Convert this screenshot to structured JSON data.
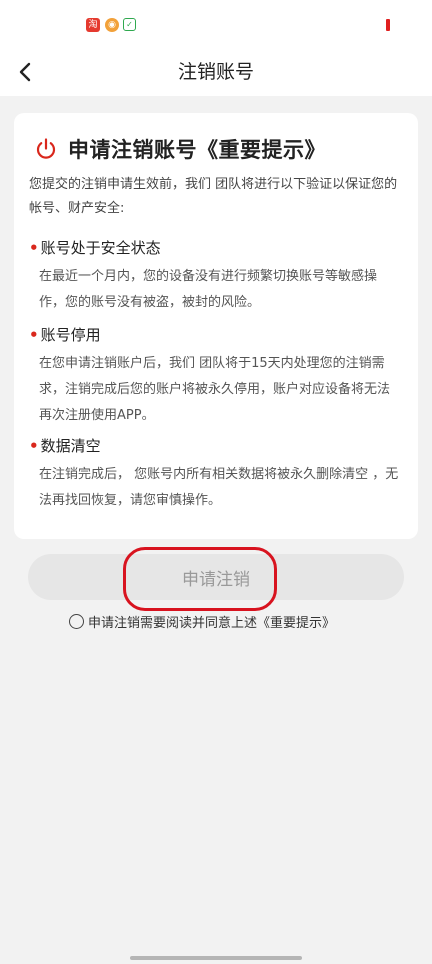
{
  "header": {
    "title": "注销账号"
  },
  "card": {
    "title": "申请注销账号《重要提示》",
    "intro": "您提交的注销申请生效前，我们 团队将进行以下验证以保证您的帐号、财产安全:",
    "sections": [
      {
        "title": "账号处于安全状态",
        "body": "在最近一个月内，您的设备没有进行频繁切换账号等敏感操作，您的账号没有被盗，被封的风险。"
      },
      {
        "title": "账号停用",
        "body": "在您申请注销账户后，我们 团队将于15天内处理您的注销需求，注销完成后您的账户将被永久停用，账户对应设备将无法再次注册使用APP。"
      },
      {
        "title": "数据清空",
        "body": "在注销完成后， 您账号内所有相关数据将被永久删除清空 ，无法再找回恢复，请您审慎操作。"
      }
    ]
  },
  "apply_button": {
    "label": "申请注销"
  },
  "agreement": {
    "text": "申请注销需要阅读并同意上述《重要提示》"
  },
  "status_icons": [
    "taobao-app-icon",
    "weibo-app-icon",
    "wechat-app-icon",
    "battery-icon"
  ],
  "colors": {
    "accent": "#d9271c",
    "button_disabled": "#e6e6e6",
    "highlight": "#d8131f"
  }
}
